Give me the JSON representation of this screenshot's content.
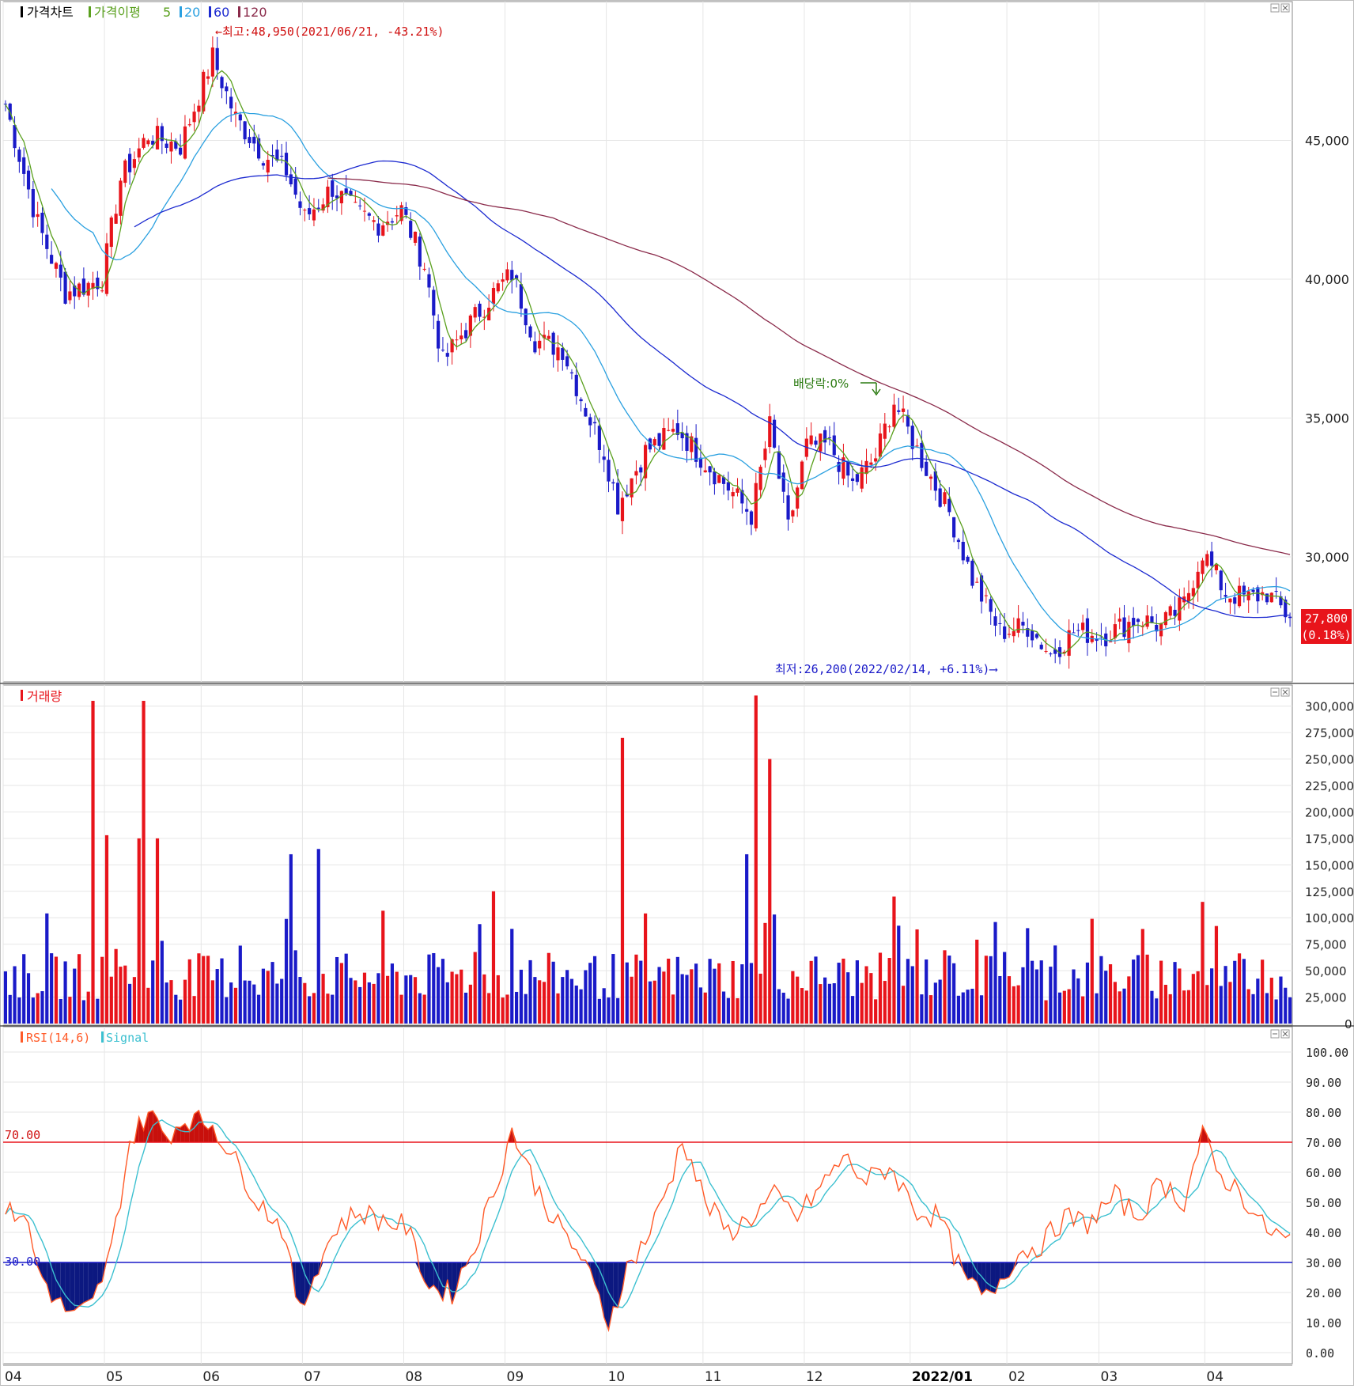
{
  "colors": {
    "up": "#e8141b",
    "down": "#1a1ac8",
    "ma5": "#5aa01e",
    "ma20": "#2aa0e0",
    "ma60": "#1c2ad0",
    "ma120": "#8a2a4a",
    "rsi": "#ff5a28",
    "signal": "#3cc0d0",
    "grid": "#e6e6e6",
    "axis": "#9a9a9a"
  },
  "price_panel": {
    "legend": {
      "title": "가격차트",
      "ma_label": "가격이평",
      "ma5": "5",
      "ma20": "20",
      "ma60": "60",
      "ma120": "120"
    },
    "high_annotation": "←최고:48,950(2021/06/21, -43.21%)",
    "low_annotation": "최저:26,200(2022/02/14, +6.11%)⟶",
    "dividend_annotation": "배당락:0%",
    "last_price": "27,800",
    "last_change": "(0.18%)",
    "y_ticks": [
      "45,000",
      "40,000",
      "35,000",
      "30,000"
    ]
  },
  "volume_panel": {
    "title": "거래량",
    "y_ticks": [
      "300,000",
      "275,000",
      "250,000",
      "225,000",
      "200,000",
      "175,000",
      "150,000",
      "125,000",
      "100,000",
      "75,000",
      "50,000",
      "25,000",
      "0"
    ]
  },
  "rsi_panel": {
    "title": "RSI(14,6)",
    "signal_label": "Signal",
    "level_high": "70.00",
    "level_low": "30.00",
    "y_ticks": [
      "100.00",
      "90.00",
      "80.00",
      "70.00",
      "60.00",
      "50.00",
      "40.00",
      "30.00",
      "20.00",
      "10.00",
      "0.00"
    ]
  },
  "x_axis": {
    "labels": [
      "04",
      "05",
      "06",
      "07",
      "08",
      "09",
      "10",
      "11",
      "12",
      "2022/01",
      "02",
      "03",
      "04"
    ]
  },
  "chart_data": [
    {
      "type": "candlestick",
      "name": "가격차트",
      "ylim": [
        25500,
        50000
      ],
      "moving_averages": [
        "5",
        "20",
        "60",
        "120"
      ],
      "anchors_date_close": [
        [
          "2021-04-01",
          46300
        ],
        [
          "2021-04-12",
          42000
        ],
        [
          "2021-04-20",
          39500
        ],
        [
          "2021-04-30",
          40000
        ],
        [
          "2021-05-06",
          43600
        ],
        [
          "2021-05-14",
          45200
        ],
        [
          "2021-05-25",
          44800
        ],
        [
          "2021-06-03",
          48000
        ],
        [
          "2021-06-10",
          45800
        ],
        [
          "2021-06-18",
          44500
        ],
        [
          "2021-06-25",
          43900
        ],
        [
          "2021-07-01",
          42200
        ],
        [
          "2021-07-09",
          43300
        ],
        [
          "2021-07-16",
          42400
        ],
        [
          "2021-07-23",
          42000
        ],
        [
          "2021-07-30",
          42500
        ],
        [
          "2021-08-06",
          40500
        ],
        [
          "2021-08-12",
          37000
        ],
        [
          "2021-08-18",
          38000
        ],
        [
          "2021-08-27",
          39500
        ],
        [
          "2021-09-02",
          40200
        ],
        [
          "2021-09-09",
          37800
        ],
        [
          "2021-09-17",
          37500
        ],
        [
          "2021-09-24",
          35300
        ],
        [
          "2021-09-30",
          33800
        ],
        [
          "2021-10-05",
          31900
        ],
        [
          "2021-10-13",
          33800
        ],
        [
          "2021-10-22",
          34600
        ],
        [
          "2021-11-01",
          33400
        ],
        [
          "2021-11-08",
          32500
        ],
        [
          "2021-11-15",
          31500
        ],
        [
          "2021-11-19",
          34700
        ],
        [
          "2021-11-25",
          31000
        ],
        [
          "2021-12-01",
          34000
        ],
        [
          "2021-12-08",
          34000
        ],
        [
          "2021-12-15",
          32600
        ],
        [
          "2021-12-22",
          33600
        ],
        [
          "2021-12-28",
          35600
        ],
        [
          "2022-01-05",
          33500
        ],
        [
          "2022-01-13",
          31600
        ],
        [
          "2022-01-20",
          29200
        ],
        [
          "2022-01-28",
          27300
        ],
        [
          "2022-02-07",
          27500
        ],
        [
          "2022-02-14",
          26500
        ],
        [
          "2022-02-21",
          27300
        ],
        [
          "2022-03-02",
          27200
        ],
        [
          "2022-03-11",
          27800
        ],
        [
          "2022-03-18",
          27500
        ],
        [
          "2022-03-25",
          28300
        ],
        [
          "2022-03-31",
          30200
        ],
        [
          "2022-04-07",
          28700
        ],
        [
          "2022-04-14",
          28500
        ],
        [
          "2022-04-20",
          28700
        ],
        [
          "2022-04-27",
          27800
        ]
      ]
    },
    {
      "type": "bar",
      "name": "거래량",
      "ylim": [
        0,
        305000
      ],
      "spikes_date_volume": [
        [
          "2021-04-28",
          305000
        ],
        [
          "2021-05-13",
          305000
        ],
        [
          "2021-05-03",
          178000
        ],
        [
          "2021-05-12",
          175000
        ],
        [
          "2021-05-18",
          175000
        ],
        [
          "2021-06-28",
          160000
        ],
        [
          "2021-07-06",
          165000
        ],
        [
          "2021-08-27",
          125000
        ],
        [
          "2021-10-06",
          270000
        ],
        [
          "2021-11-16",
          310000
        ],
        [
          "2021-11-19",
          250000
        ],
        [
          "2021-11-12",
          160000
        ],
        [
          "2021-12-28",
          120000
        ],
        [
          "2022-03-31",
          115000
        ]
      ]
    },
    {
      "type": "line",
      "name": "RSI(14,6)",
      "series": [
        {
          "name": "RSI(14,6)"
        },
        {
          "name": "Signal"
        }
      ],
      "ylim": [
        0,
        100
      ],
      "reference_lines": [
        70,
        30
      ],
      "anchors_date_rsi": [
        [
          "2021-04-01",
          46
        ],
        [
          "2021-04-07",
          47
        ],
        [
          "2021-04-12",
          28
        ],
        [
          "2021-04-16",
          17
        ],
        [
          "2021-04-22",
          12
        ],
        [
          "2021-04-28",
          16
        ],
        [
          "2021-05-04",
          34
        ],
        [
          "2021-05-10",
          70
        ],
        [
          "2021-05-14",
          80
        ],
        [
          "2021-05-20",
          72
        ],
        [
          "2021-05-26",
          78
        ],
        [
          "2021-06-03",
          76
        ],
        [
          "2021-06-09",
          66
        ],
        [
          "2021-06-17",
          50
        ],
        [
          "2021-06-24",
          42
        ],
        [
          "2021-06-30",
          13
        ],
        [
          "2021-07-06",
          30
        ],
        [
          "2021-07-12",
          42
        ],
        [
          "2021-07-19",
          47
        ],
        [
          "2021-07-26",
          44
        ],
        [
          "2021-08-02",
          42
        ],
        [
          "2021-08-09",
          22
        ],
        [
          "2021-08-16",
          20
        ],
        [
          "2021-08-23",
          36
        ],
        [
          "2021-08-30",
          58
        ],
        [
          "2021-09-02",
          74
        ],
        [
          "2021-09-09",
          56
        ],
        [
          "2021-09-16",
          42
        ],
        [
          "2021-09-23",
          32
        ],
        [
          "2021-10-01",
          10
        ],
        [
          "2021-10-07",
          28
        ],
        [
          "2021-10-14",
          40
        ],
        [
          "2021-10-21",
          60
        ],
        [
          "2021-10-25",
          72
        ],
        [
          "2021-11-01",
          50
        ],
        [
          "2021-11-08",
          40
        ],
        [
          "2021-11-15",
          45
        ],
        [
          "2021-11-22",
          52
        ],
        [
          "2021-11-29",
          45
        ],
        [
          "2021-12-06",
          55
        ],
        [
          "2021-12-13",
          65
        ],
        [
          "2021-12-20",
          57
        ],
        [
          "2021-12-27",
          62
        ],
        [
          "2022-01-04",
          47
        ],
        [
          "2022-01-11",
          45
        ],
        [
          "2022-01-18",
          25
        ],
        [
          "2022-01-25",
          18
        ],
        [
          "2022-02-03",
          33
        ],
        [
          "2022-02-10",
          36
        ],
        [
          "2022-02-17",
          45
        ],
        [
          "2022-02-24",
          43
        ],
        [
          "2022-03-04",
          52
        ],
        [
          "2022-03-11",
          45
        ],
        [
          "2022-03-18",
          57
        ],
        [
          "2022-03-25",
          50
        ],
        [
          "2022-03-31",
          73
        ],
        [
          "2022-04-05",
          60
        ],
        [
          "2022-04-12",
          54
        ],
        [
          "2022-04-19",
          42
        ],
        [
          "2022-04-27",
          37
        ]
      ]
    }
  ]
}
